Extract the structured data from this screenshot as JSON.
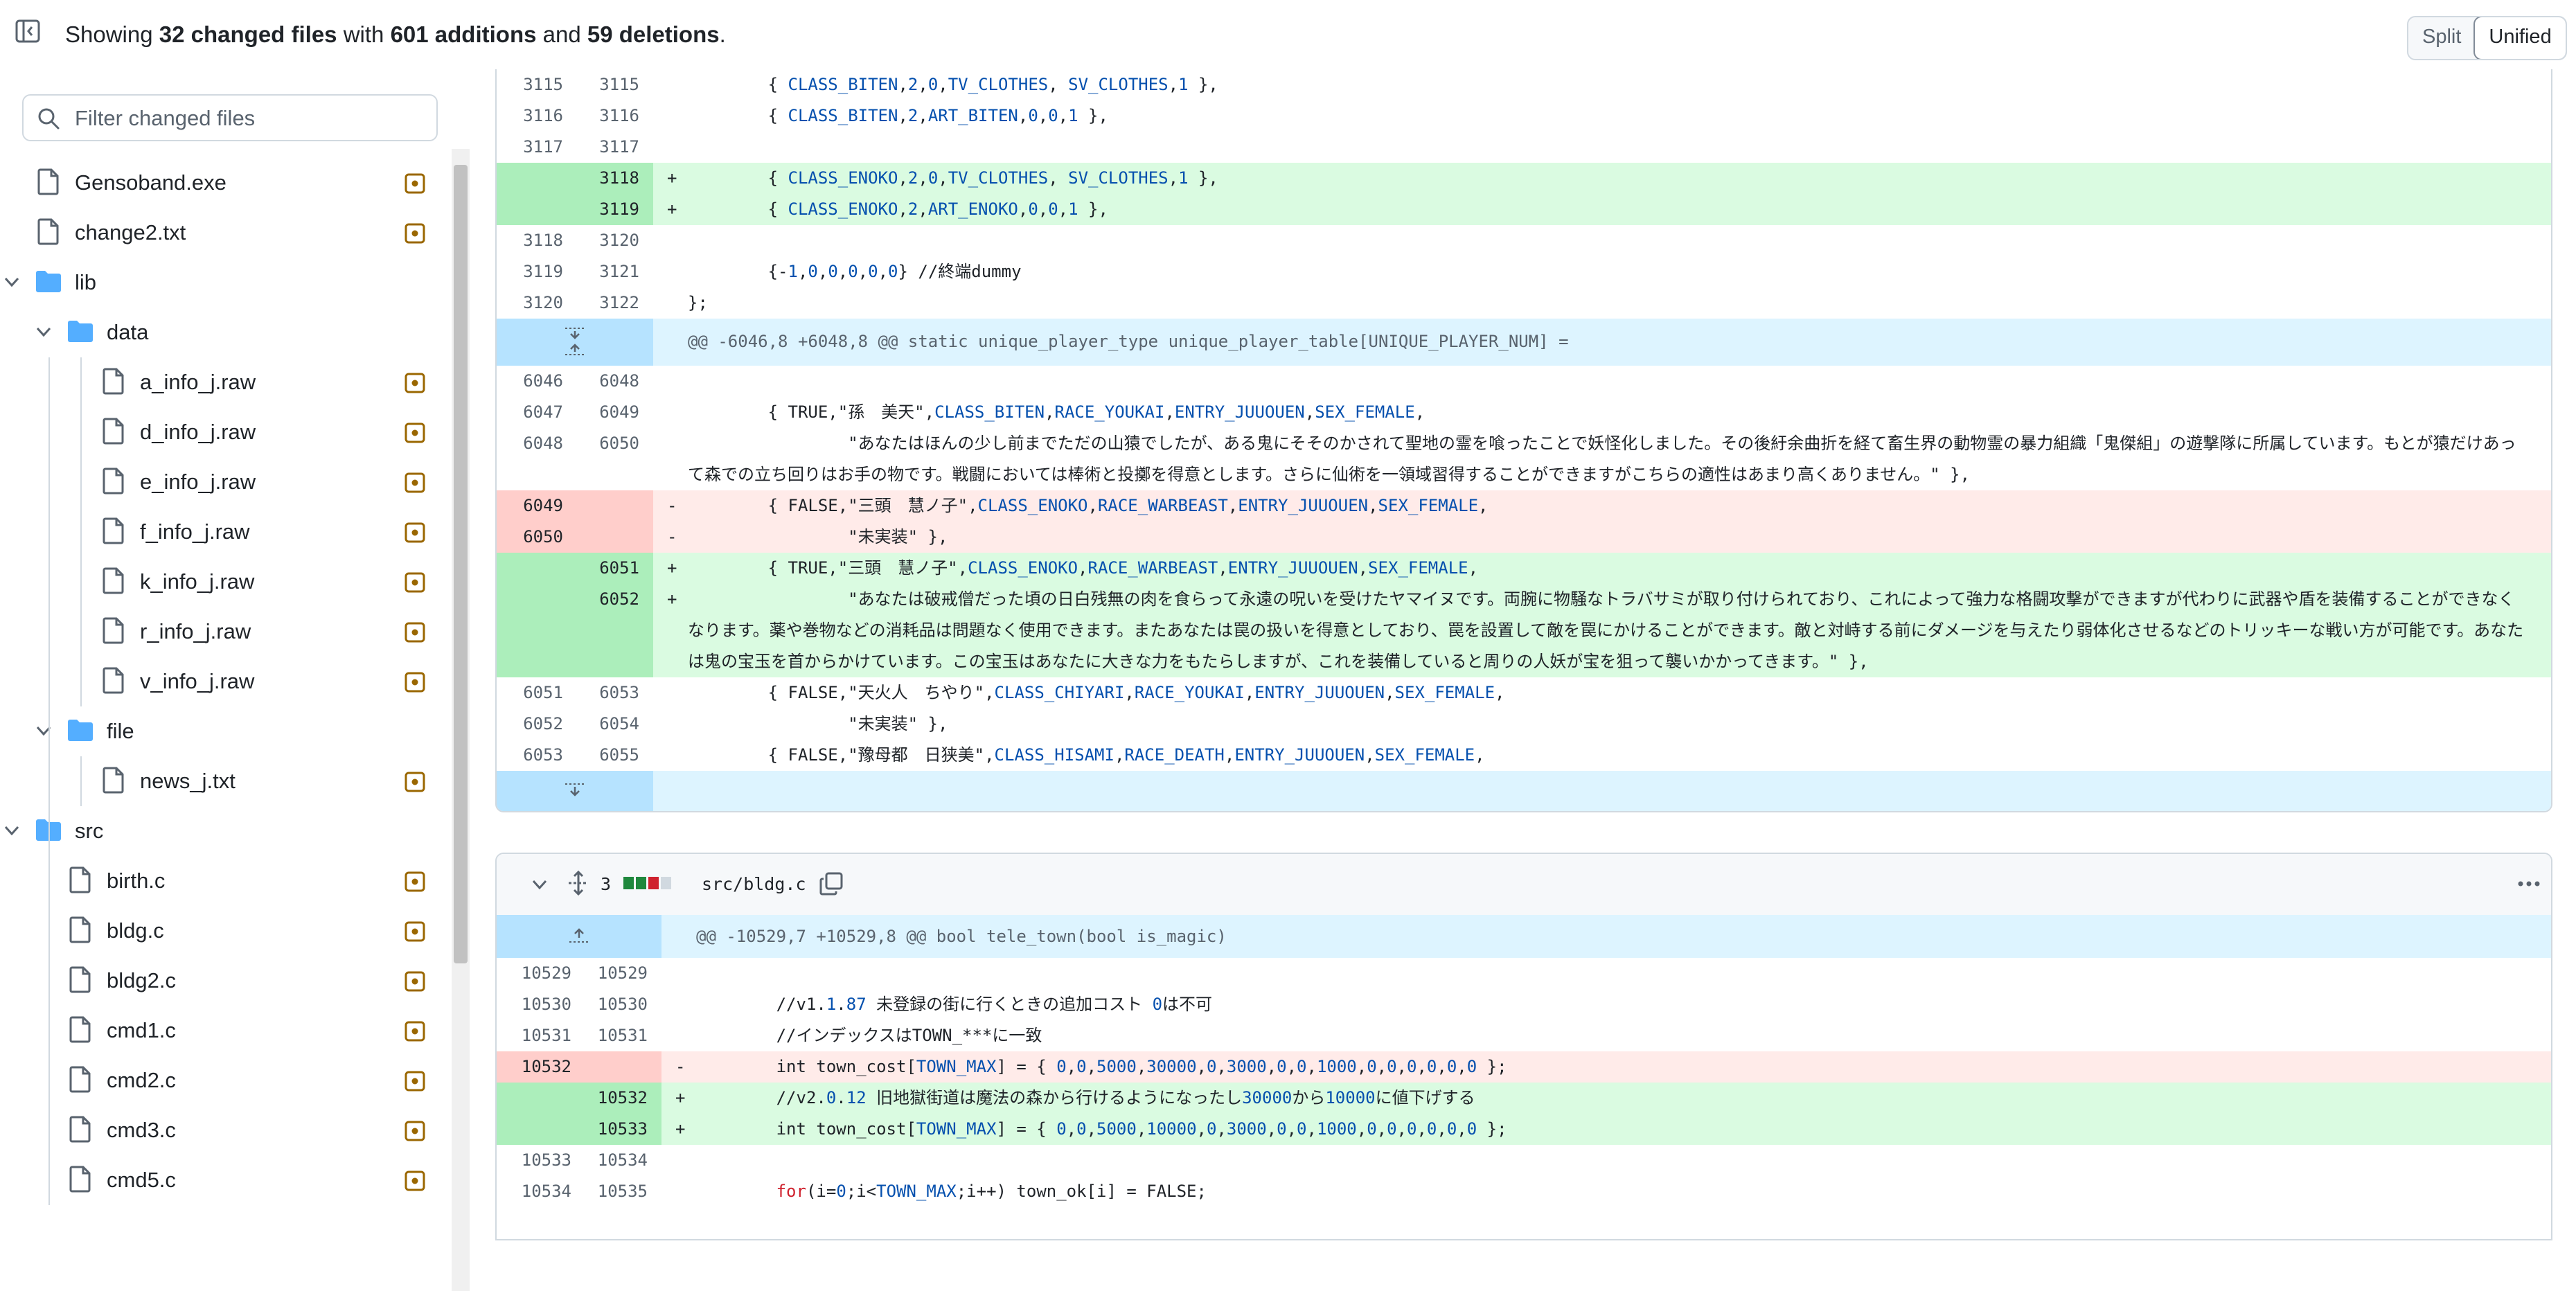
{
  "header": {
    "summary_prefix": "Showing",
    "changed_files": "32 changed files",
    "with_text": "with",
    "additions": "601 additions",
    "and_text": "and",
    "deletions": "59 deletions",
    "period": ".",
    "view_split": "Split",
    "view_unified": "Unified",
    "active_view": "Unified"
  },
  "sidebar": {
    "filter_placeholder": "Filter changed files",
    "items": [
      {
        "label": "Gensoband.exe",
        "type": "file",
        "depth": 0
      },
      {
        "label": "change2.txt",
        "type": "file",
        "depth": 0
      },
      {
        "label": "lib",
        "type": "folder",
        "depth": 0
      },
      {
        "label": "data",
        "type": "folder",
        "depth": 1
      },
      {
        "label": "a_info_j.raw",
        "type": "file",
        "depth": 2
      },
      {
        "label": "d_info_j.raw",
        "type": "file",
        "depth": 2
      },
      {
        "label": "e_info_j.raw",
        "type": "file",
        "depth": 2
      },
      {
        "label": "f_info_j.raw",
        "type": "file",
        "depth": 2
      },
      {
        "label": "k_info_j.raw",
        "type": "file",
        "depth": 2
      },
      {
        "label": "r_info_j.raw",
        "type": "file",
        "depth": 2
      },
      {
        "label": "v_info_j.raw",
        "type": "file",
        "depth": 2
      },
      {
        "label": "file",
        "type": "folder",
        "depth": 1
      },
      {
        "label": "news_j.txt",
        "type": "file",
        "depth": 2
      },
      {
        "label": "src",
        "type": "folder",
        "depth": 0
      },
      {
        "label": "birth.c",
        "type": "file",
        "depth": 1
      },
      {
        "label": "bldg.c",
        "type": "file",
        "depth": 1
      },
      {
        "label": "bldg2.c",
        "type": "file",
        "depth": 1
      },
      {
        "label": "cmd1.c",
        "type": "file",
        "depth": 1
      },
      {
        "label": "cmd2.c",
        "type": "file",
        "depth": 1
      },
      {
        "label": "cmd3.c",
        "type": "file",
        "depth": 1
      },
      {
        "label": "cmd5.c",
        "type": "file",
        "depth": 1
      }
    ]
  },
  "diff1": {
    "rows": [
      {
        "kind": "ctx",
        "old": "3115",
        "new": "3115",
        "code": "        { CLASS_BITEN,2,0,TV_CLOTHES, SV_CLOTHES,1 },"
      },
      {
        "kind": "ctx",
        "old": "3116",
        "new": "3116",
        "code": "        { CLASS_BITEN,2,ART_BITEN,0,0,1 },"
      },
      {
        "kind": "ctx",
        "old": "3117",
        "new": "3117",
        "code": ""
      },
      {
        "kind": "add",
        "old": "",
        "new": "3118",
        "code": "        { CLASS_ENOKO,2,0,TV_CLOTHES, SV_CLOTHES,1 },"
      },
      {
        "kind": "add",
        "old": "",
        "new": "3119",
        "code": "        { CLASS_ENOKO,2,ART_ENOKO,0,0,1 },"
      },
      {
        "kind": "ctx",
        "old": "3118",
        "new": "3120",
        "code": ""
      },
      {
        "kind": "ctx",
        "old": "3119",
        "new": "3121",
        "code": "        {-1,0,0,0,0,0} //終端dummy"
      },
      {
        "kind": "ctx",
        "old": "3120",
        "new": "3122",
        "code": "};"
      },
      {
        "kind": "hunk",
        "old": "",
        "new": "",
        "code": "@@ -6046,8 +6048,8 @@ static unique_player_type unique_player_table[UNIQUE_PLAYER_NUM] ="
      },
      {
        "kind": "ctx",
        "old": "6046",
        "new": "6048",
        "code": ""
      },
      {
        "kind": "ctx",
        "old": "6047",
        "new": "6049",
        "code": "        { TRUE,\"孫　美天\",CLASS_BITEN,RACE_YOUKAI,ENTRY_JUUOUEN,SEX_FEMALE,"
      },
      {
        "kind": "ctx",
        "old": "6048",
        "new": "6050",
        "code": "                \"あなたはほんの少し前までただの山猿でしたが、ある鬼にそそのかされて聖地の霊を喰ったことで妖怪化しました。その後紆余曲折を経て畜生界の動物霊の暴力組織「鬼傑組」の遊撃隊に所属しています。もとが猿だけあって森での立ち回りはお手の物です。戦闘においては棒術と投擲を得意とします。さらに仙術を一領域習得することができますがこちらの適性はあまり高くありません。\" },"
      },
      {
        "kind": "del",
        "old": "6049",
        "new": "",
        "code": "        { FALSE,\"三頭　慧ノ子\",CLASS_ENOKO,RACE_WARBEAST,ENTRY_JUUOUEN,SEX_FEMALE,"
      },
      {
        "kind": "del",
        "old": "6050",
        "new": "",
        "code": "                \"未実装\" },"
      },
      {
        "kind": "add",
        "old": "",
        "new": "6051",
        "code": "        { TRUE,\"三頭　慧ノ子\",CLASS_ENOKO,RACE_WARBEAST,ENTRY_JUUOUEN,SEX_FEMALE,"
      },
      {
        "kind": "add",
        "old": "",
        "new": "6052",
        "code": "                \"あなたは破戒僧だった頃の日白残無の肉を食らって永遠の呪いを受けたヤマイヌです。両腕に物騒なトラバサミが取り付けられており、これによって強力な格闘攻撃ができますが代わりに武器や盾を装備することができなくなります。薬や巻物などの消耗品は問題なく使用できます。またあなたは罠の扱いを得意としており、罠を設置して敵を罠にかけることができます。敵と対峙する前にダメージを与えたり弱体化させるなどのトリッキーな戦い方が可能です。あなたは鬼の宝玉を首からかけています。この宝玉はあなたに大きな力をもたらしますが、これを装備していると周りの人妖が宝を狙って襲いかかってきます。\" },"
      },
      {
        "kind": "ctx",
        "old": "6051",
        "new": "6053",
        "code": "        { FALSE,\"天火人　ちやり\",CLASS_CHIYARI,RACE_YOUKAI,ENTRY_JUUOUEN,SEX_FEMALE,"
      },
      {
        "kind": "ctx",
        "old": "6052",
        "new": "6054",
        "code": "                \"未実装\" },"
      },
      {
        "kind": "ctx",
        "old": "6053",
        "new": "6055",
        "code": "        { FALSE,\"豫母都　日狭美\",CLASS_HISAMI,RACE_DEATH,ENTRY_JUUOUEN,SEX_FEMALE,"
      }
    ]
  },
  "diff2": {
    "file_path": "src/bldg.c",
    "change_count": "3",
    "hunk": "@@ -10529,7 +10529,8 @@ bool tele_town(bool is_magic)",
    "rows": [
      {
        "kind": "ctx",
        "old": "10529",
        "new": "10529",
        "code": ""
      },
      {
        "kind": "ctx",
        "old": "10530",
        "new": "10530",
        "code": "        //v1.1.87 未登録の街に行くときの追加コスト 0は不可"
      },
      {
        "kind": "ctx",
        "old": "10531",
        "new": "10531",
        "code": "        //インデックスはTOWN_***に一致"
      },
      {
        "kind": "del",
        "old": "10532",
        "new": "",
        "code": "        int town_cost[TOWN_MAX] = { 0,0,5000,30000,0,3000,0,0,1000,0,0,0,0,0,0 };"
      },
      {
        "kind": "add",
        "old": "",
        "new": "10532",
        "code": "        //v2.0.12 旧地獄街道は魔法の森から行けるようになったし30000から10000に値下げする"
      },
      {
        "kind": "add",
        "old": "",
        "new": "10533",
        "code": "        int town_cost[TOWN_MAX] = { 0,0,5000,10000,0,3000,0,0,1000,0,0,0,0,0,0 };"
      },
      {
        "kind": "ctx",
        "old": "10533",
        "new": "10534",
        "code": ""
      },
      {
        "kind": "ctx",
        "old": "10534",
        "new": "10535",
        "code": "        for(i=0;i<TOWN_MAX;i++) town_ok[i] = FALSE;"
      }
    ]
  },
  "colors": {
    "add_bg": "#dafbe1",
    "add_num": "#aceebb",
    "del_bg": "#ffebe9",
    "del_num": "#ffcecb",
    "hunk_bg": "#ddf4ff",
    "hunk_num": "#b6e3ff",
    "status_icon": "#9a6700",
    "folder": "#54aeff"
  }
}
